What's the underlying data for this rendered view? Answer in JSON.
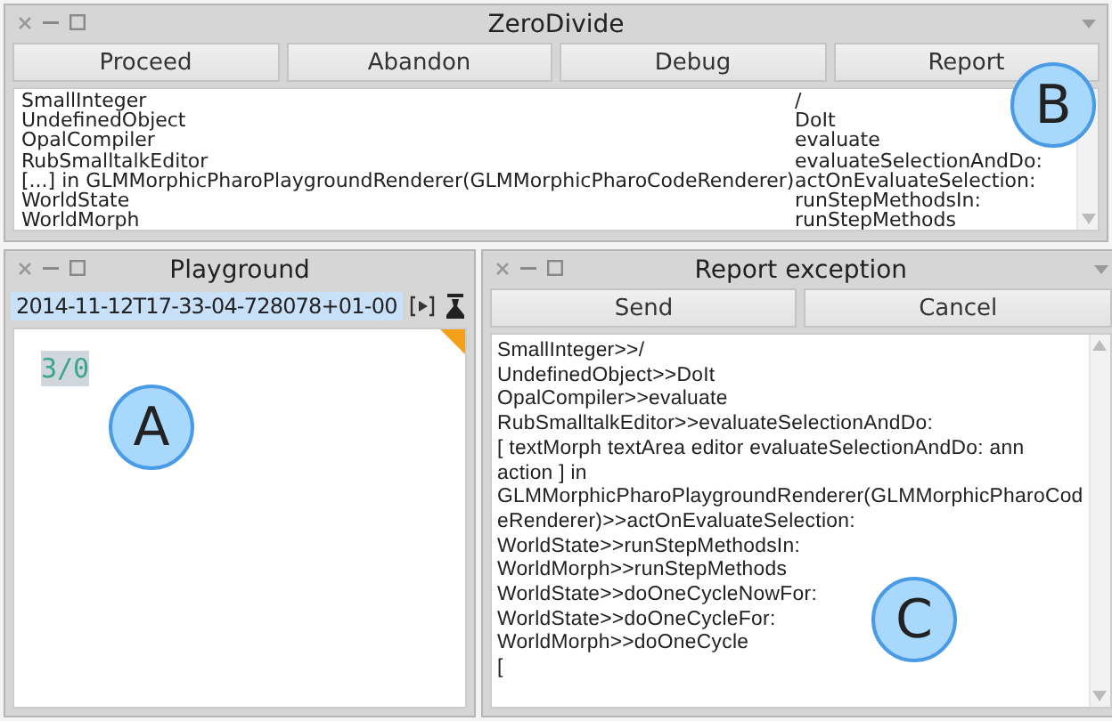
{
  "debugger": {
    "title": "ZeroDivide",
    "menu_button": true,
    "callout": "B",
    "buttons": [
      "Proceed",
      "Abandon",
      "Debug",
      "Report"
    ],
    "stack": [
      {
        "receiver": "SmallInteger",
        "selector": "/"
      },
      {
        "receiver": "UndefinedObject",
        "selector": "DoIt"
      },
      {
        "receiver": "OpalCompiler",
        "selector": "evaluate"
      },
      {
        "receiver": "RubSmalltalkEditor",
        "selector": "evaluateSelectionAndDo:"
      },
      {
        "receiver": "[...] in GLMMorphicPharoPlaygroundRenderer(GLMMorphicPharoCodeRenderer)",
        "selector": "actOnEvaluateSelection:"
      },
      {
        "receiver": "WorldState",
        "selector": "runStepMethodsIn:"
      },
      {
        "receiver": "WorldMorph",
        "selector": "runStepMethods"
      }
    ]
  },
  "playground": {
    "title": "Playground",
    "menu_button": false,
    "callout": "A",
    "page_tab": {
      "label": "2014-11-12T17-33-04-728078+01-00",
      "selected": true
    },
    "code": "3/0",
    "code_selected": true
  },
  "report": {
    "title": "Report exception",
    "menu_button": true,
    "callout": "C",
    "buttons": [
      "Send",
      "Cancel"
    ],
    "trace": [
      "SmallInteger>>/",
      "UndefinedObject>>DoIt",
      "OpalCompiler>>evaluate",
      "RubSmalltalkEditor>>evaluateSelectionAndDo:",
      "[ textMorph textArea editor evaluateSelectionAndDo: ann",
      "action ] in",
      "GLMMorphicPharoPlaygroundRenderer(GLMMorphicPharoCod",
      "eRenderer)>>actOnEvaluateSelection:",
      "WorldState>>runStepMethodsIn:",
      "WorldMorph>>runStepMethods",
      "WorldState>>doOneCycleNowFor:",
      "WorldState>>doOneCycleFor:",
      "WorldMorph>>doOneCycle",
      "["
    ]
  }
}
